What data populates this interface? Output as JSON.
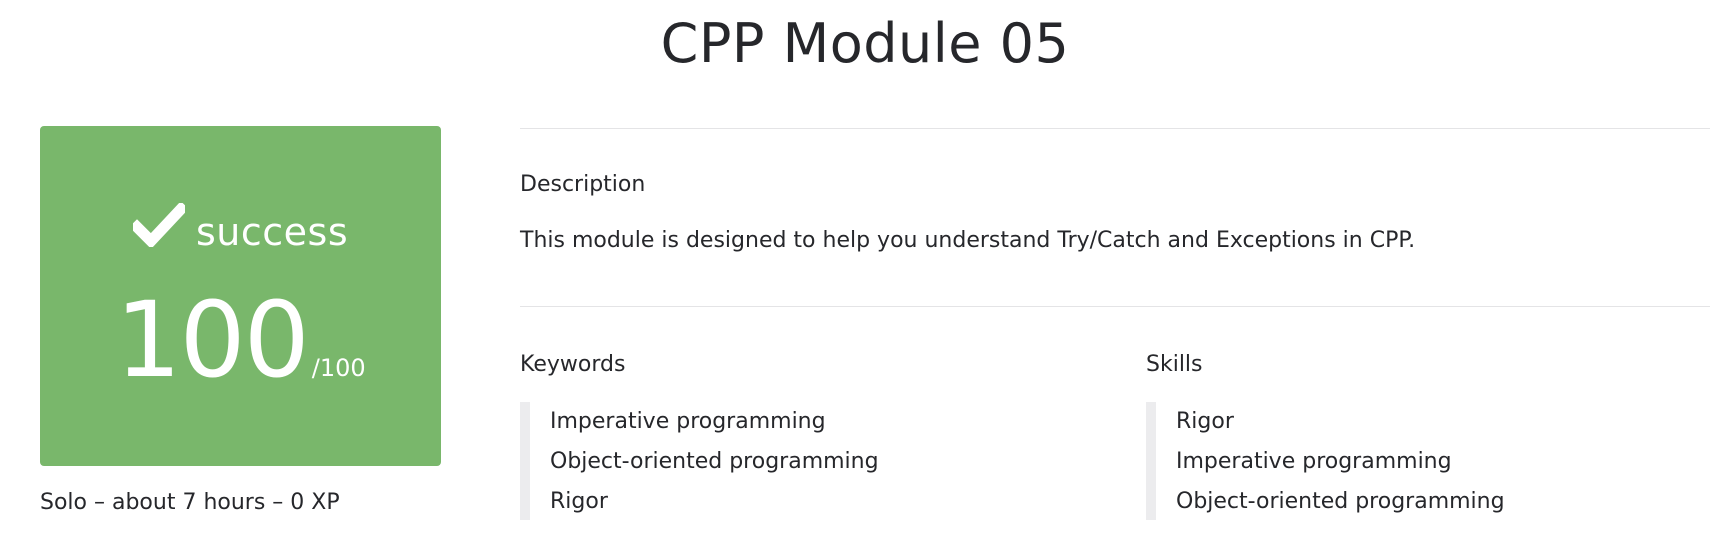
{
  "page": {
    "title": "CPP Module 05"
  },
  "score_card": {
    "status_icon": "check-icon",
    "status": "success",
    "score": "100",
    "score_max": "/100",
    "background_color": "#79b76b"
  },
  "meta": {
    "summary": "Solo – about 7 hours – 0 XP"
  },
  "description": {
    "heading": "Description",
    "text": "This module is designed to help you understand Try/Catch and Exceptions in CPP."
  },
  "keywords": {
    "heading": "Keywords",
    "items": [
      "Imperative programming",
      "Object-oriented programming",
      "Rigor"
    ]
  },
  "skills": {
    "heading": "Skills",
    "items": [
      "Rigor",
      "Imperative programming",
      "Object-oriented programming"
    ]
  }
}
